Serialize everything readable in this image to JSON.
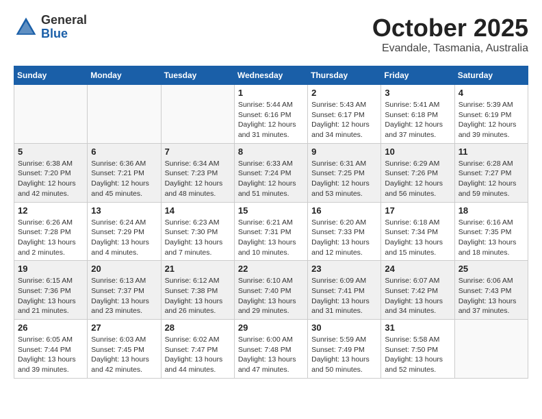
{
  "header": {
    "logo_general": "General",
    "logo_blue": "Blue",
    "month": "October 2025",
    "location": "Evandale, Tasmania, Australia"
  },
  "weekdays": [
    "Sunday",
    "Monday",
    "Tuesday",
    "Wednesday",
    "Thursday",
    "Friday",
    "Saturday"
  ],
  "weeks": [
    [
      {
        "day": "",
        "info": ""
      },
      {
        "day": "",
        "info": ""
      },
      {
        "day": "",
        "info": ""
      },
      {
        "day": "1",
        "info": "Sunrise: 5:44 AM\nSunset: 6:16 PM\nDaylight: 12 hours\nand 31 minutes."
      },
      {
        "day": "2",
        "info": "Sunrise: 5:43 AM\nSunset: 6:17 PM\nDaylight: 12 hours\nand 34 minutes."
      },
      {
        "day": "3",
        "info": "Sunrise: 5:41 AM\nSunset: 6:18 PM\nDaylight: 12 hours\nand 37 minutes."
      },
      {
        "day": "4",
        "info": "Sunrise: 5:39 AM\nSunset: 6:19 PM\nDaylight: 12 hours\nand 39 minutes."
      }
    ],
    [
      {
        "day": "5",
        "info": "Sunrise: 6:38 AM\nSunset: 7:20 PM\nDaylight: 12 hours\nand 42 minutes."
      },
      {
        "day": "6",
        "info": "Sunrise: 6:36 AM\nSunset: 7:21 PM\nDaylight: 12 hours\nand 45 minutes."
      },
      {
        "day": "7",
        "info": "Sunrise: 6:34 AM\nSunset: 7:23 PM\nDaylight: 12 hours\nand 48 minutes."
      },
      {
        "day": "8",
        "info": "Sunrise: 6:33 AM\nSunset: 7:24 PM\nDaylight: 12 hours\nand 51 minutes."
      },
      {
        "day": "9",
        "info": "Sunrise: 6:31 AM\nSunset: 7:25 PM\nDaylight: 12 hours\nand 53 minutes."
      },
      {
        "day": "10",
        "info": "Sunrise: 6:29 AM\nSunset: 7:26 PM\nDaylight: 12 hours\nand 56 minutes."
      },
      {
        "day": "11",
        "info": "Sunrise: 6:28 AM\nSunset: 7:27 PM\nDaylight: 12 hours\nand 59 minutes."
      }
    ],
    [
      {
        "day": "12",
        "info": "Sunrise: 6:26 AM\nSunset: 7:28 PM\nDaylight: 13 hours\nand 2 minutes."
      },
      {
        "day": "13",
        "info": "Sunrise: 6:24 AM\nSunset: 7:29 PM\nDaylight: 13 hours\nand 4 minutes."
      },
      {
        "day": "14",
        "info": "Sunrise: 6:23 AM\nSunset: 7:30 PM\nDaylight: 13 hours\nand 7 minutes."
      },
      {
        "day": "15",
        "info": "Sunrise: 6:21 AM\nSunset: 7:31 PM\nDaylight: 13 hours\nand 10 minutes."
      },
      {
        "day": "16",
        "info": "Sunrise: 6:20 AM\nSunset: 7:33 PM\nDaylight: 13 hours\nand 12 minutes."
      },
      {
        "day": "17",
        "info": "Sunrise: 6:18 AM\nSunset: 7:34 PM\nDaylight: 13 hours\nand 15 minutes."
      },
      {
        "day": "18",
        "info": "Sunrise: 6:16 AM\nSunset: 7:35 PM\nDaylight: 13 hours\nand 18 minutes."
      }
    ],
    [
      {
        "day": "19",
        "info": "Sunrise: 6:15 AM\nSunset: 7:36 PM\nDaylight: 13 hours\nand 21 minutes."
      },
      {
        "day": "20",
        "info": "Sunrise: 6:13 AM\nSunset: 7:37 PM\nDaylight: 13 hours\nand 23 minutes."
      },
      {
        "day": "21",
        "info": "Sunrise: 6:12 AM\nSunset: 7:38 PM\nDaylight: 13 hours\nand 26 minutes."
      },
      {
        "day": "22",
        "info": "Sunrise: 6:10 AM\nSunset: 7:40 PM\nDaylight: 13 hours\nand 29 minutes."
      },
      {
        "day": "23",
        "info": "Sunrise: 6:09 AM\nSunset: 7:41 PM\nDaylight: 13 hours\nand 31 minutes."
      },
      {
        "day": "24",
        "info": "Sunrise: 6:07 AM\nSunset: 7:42 PM\nDaylight: 13 hours\nand 34 minutes."
      },
      {
        "day": "25",
        "info": "Sunrise: 6:06 AM\nSunset: 7:43 PM\nDaylight: 13 hours\nand 37 minutes."
      }
    ],
    [
      {
        "day": "26",
        "info": "Sunrise: 6:05 AM\nSunset: 7:44 PM\nDaylight: 13 hours\nand 39 minutes."
      },
      {
        "day": "27",
        "info": "Sunrise: 6:03 AM\nSunset: 7:45 PM\nDaylight: 13 hours\nand 42 minutes."
      },
      {
        "day": "28",
        "info": "Sunrise: 6:02 AM\nSunset: 7:47 PM\nDaylight: 13 hours\nand 44 minutes."
      },
      {
        "day": "29",
        "info": "Sunrise: 6:00 AM\nSunset: 7:48 PM\nDaylight: 13 hours\nand 47 minutes."
      },
      {
        "day": "30",
        "info": "Sunrise: 5:59 AM\nSunset: 7:49 PM\nDaylight: 13 hours\nand 50 minutes."
      },
      {
        "day": "31",
        "info": "Sunrise: 5:58 AM\nSunset: 7:50 PM\nDaylight: 13 hours\nand 52 minutes."
      },
      {
        "day": "",
        "info": ""
      }
    ]
  ]
}
